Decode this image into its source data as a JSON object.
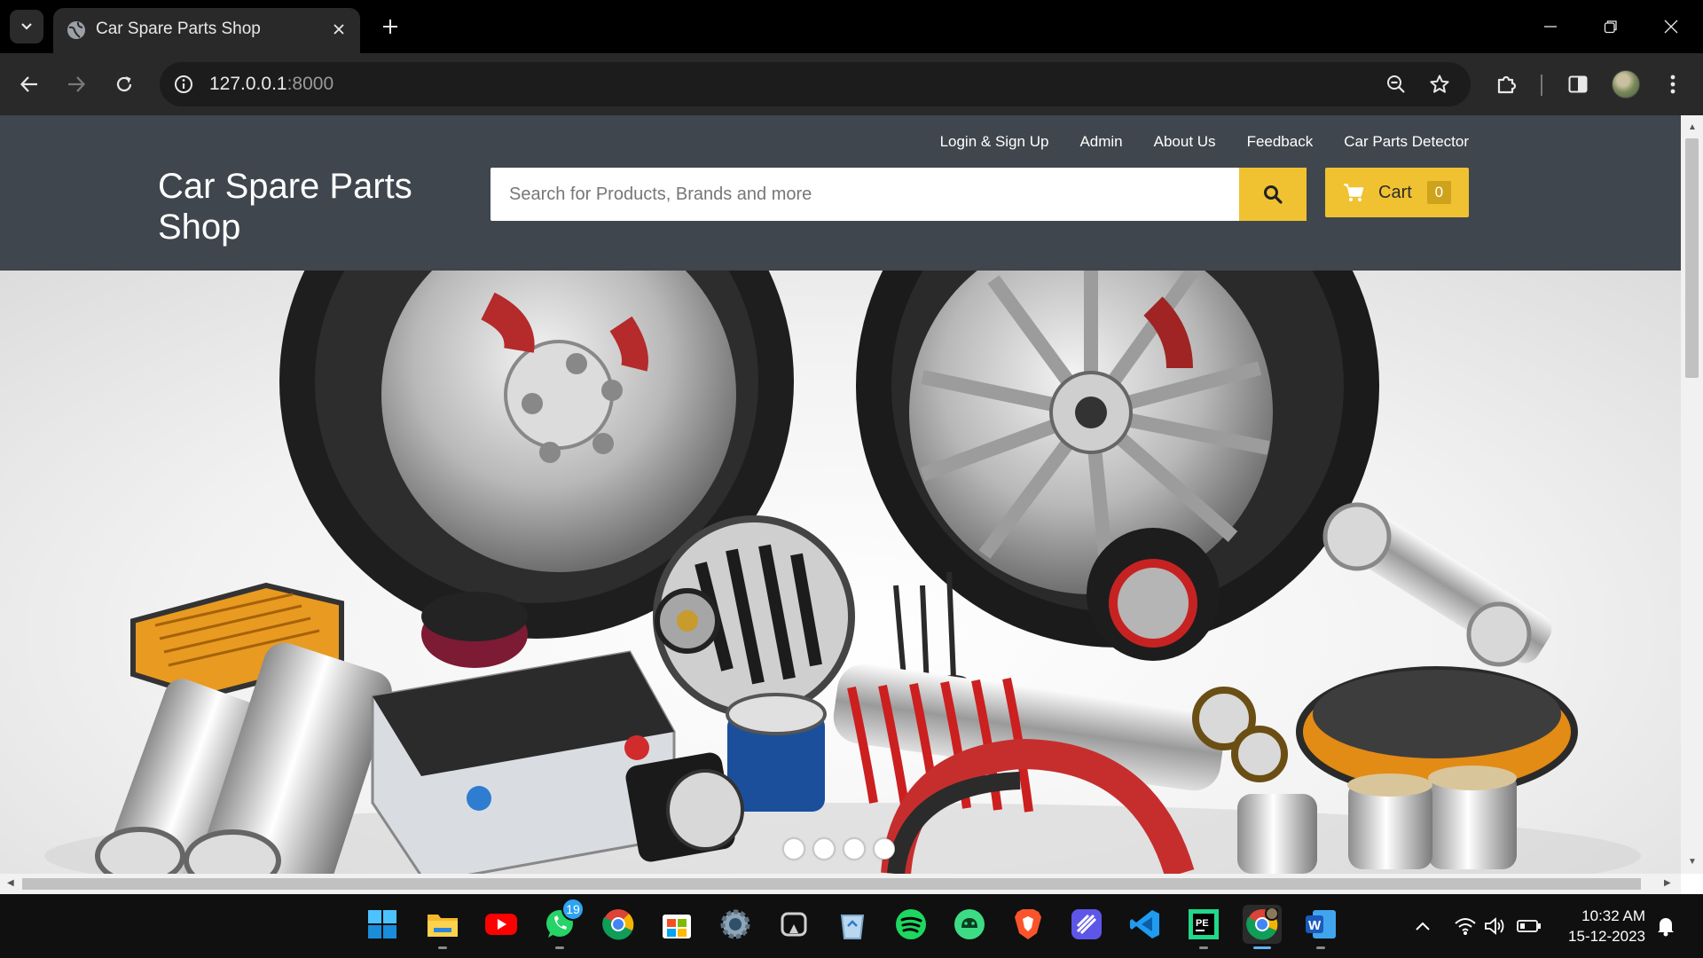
{
  "browser": {
    "tab_title": "Car Spare Parts Shop",
    "url_host": "127.0.0.1",
    "url_port": ":8000"
  },
  "site": {
    "brand": "Car Spare Parts Shop",
    "nav": [
      "Login & Sign Up",
      "Admin",
      "About Us",
      "Feedback",
      "Car Parts Detector"
    ],
    "search_placeholder": "Search for Products, Brands and more",
    "cart_label": "Cart",
    "cart_count": "0",
    "accent_color": "#f0c232",
    "header_color": "#3f464e",
    "carousel": {
      "slides": 4
    }
  },
  "taskbar": {
    "apps": [
      "windows-start",
      "file-explorer",
      "youtube",
      "whatsapp",
      "chrome",
      "microsoft-store",
      "settings",
      "snipping-tool",
      "recycle-bin",
      "spotify",
      "android-studio",
      "brave",
      "linear",
      "vs-code",
      "pycharm",
      "chrome",
      "word"
    ],
    "whatsapp_badge": "19",
    "time": "10:32 AM",
    "date": "15-12-2023"
  }
}
